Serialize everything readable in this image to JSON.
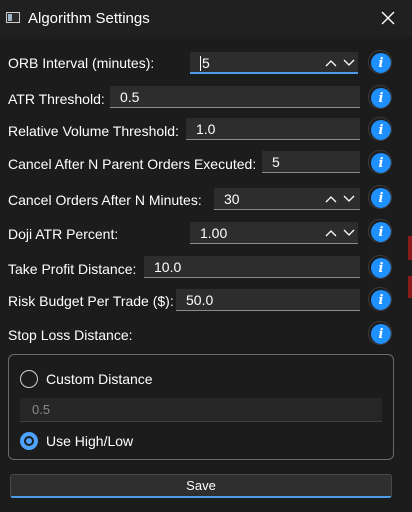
{
  "window": {
    "title": "Algorithm Settings"
  },
  "fields": {
    "orb_interval": {
      "label": "ORB Interval (minutes):",
      "value": "5"
    },
    "atr_threshold": {
      "label": "ATR Threshold:",
      "value": "0.5"
    },
    "rel_volume": {
      "label": "Relative Volume Threshold:",
      "value": "1.0"
    },
    "cancel_after_parent": {
      "label": "Cancel After N Parent Orders Executed:",
      "value": "5"
    },
    "cancel_after_minutes": {
      "label": "Cancel Orders After N Minutes:",
      "value": "30"
    },
    "doji_atr": {
      "label": "Doji ATR Percent:",
      "value": "1.00"
    },
    "take_profit": {
      "label": "Take Profit Distance:",
      "value": "10.0"
    },
    "risk_budget": {
      "label": "Risk Budget Per Trade ($):",
      "value": "50.0"
    },
    "stop_loss": {
      "label": "Stop Loss Distance:"
    }
  },
  "stop_loss_group": {
    "custom_label": "Custom Distance",
    "custom_selected": false,
    "custom_value": "0.5",
    "highlow_label": "Use High/Low",
    "highlow_selected": true
  },
  "save_label": "Save",
  "icons": {
    "app": "window-icon",
    "close": "close-icon",
    "info": "info-icon",
    "spin_up": "chevron-up-icon",
    "spin_down": "chevron-down-icon"
  },
  "colors": {
    "accent": "#1e90ff",
    "background": "#1c1c1c"
  }
}
